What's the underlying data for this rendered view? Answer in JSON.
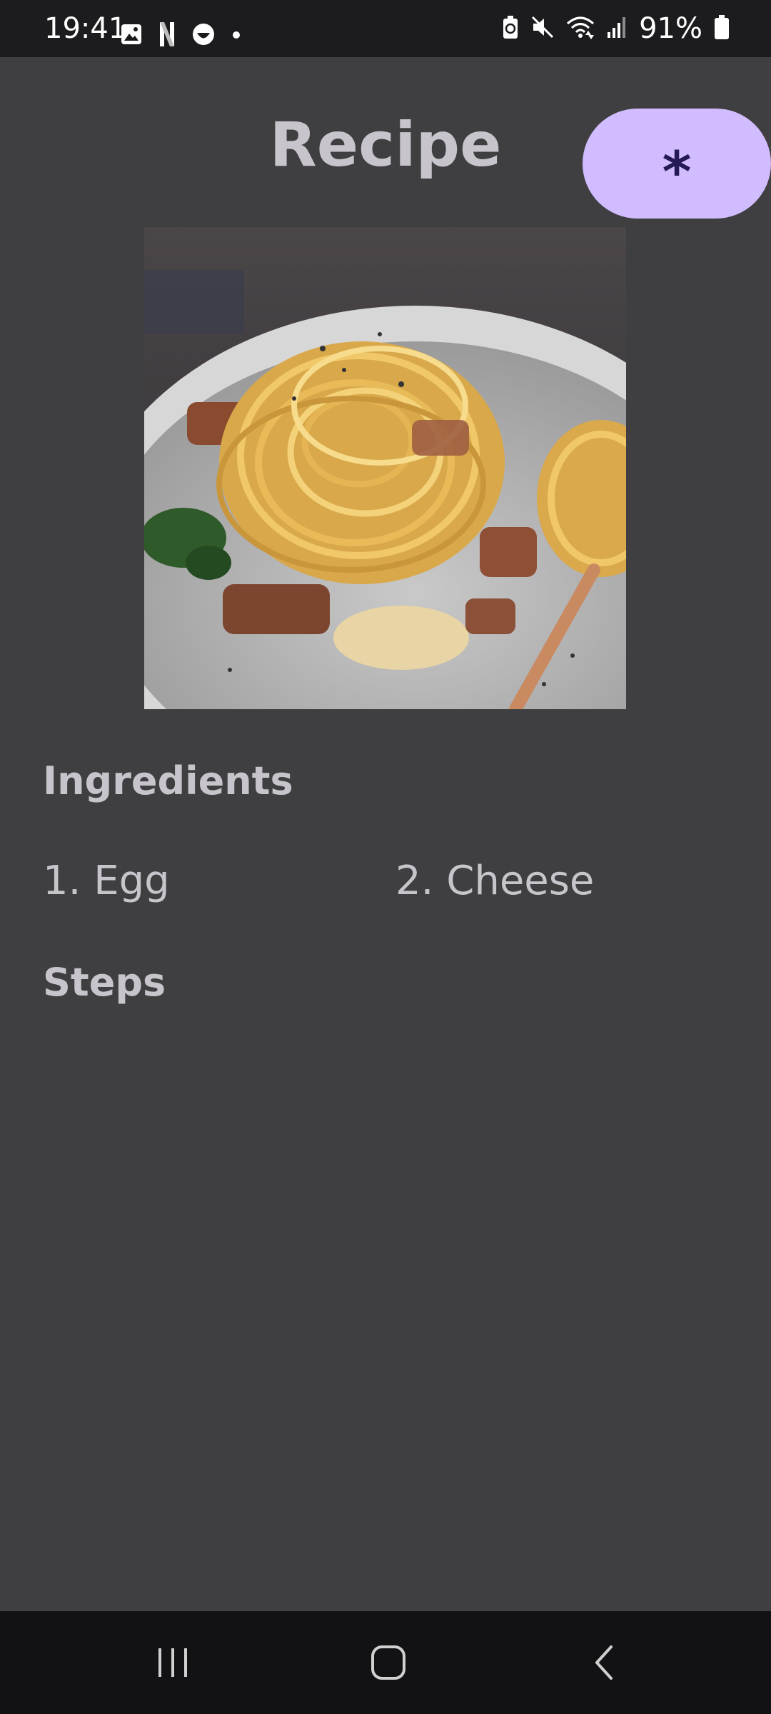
{
  "status_bar": {
    "time": "19:41",
    "battery_percent": "91%",
    "left_icons": [
      "gallery-icon",
      "netflix-icon",
      "face-icon",
      "dot-icon"
    ],
    "right_icons": [
      "battery-saver-icon",
      "mute-icon",
      "wifi-icon",
      "signal-icon",
      "battery-icon"
    ]
  },
  "header": {
    "title": "Recipe",
    "action_label": "*"
  },
  "recipe": {
    "image_alt": "pasta-carbonara",
    "ingredients_heading": "Ingredients",
    "ingredients": [
      "1. Egg",
      "2. Cheese"
    ],
    "steps_heading": "Steps"
  },
  "nav": {
    "buttons": [
      "recent-apps",
      "home",
      "back"
    ]
  },
  "colors": {
    "background": "#3f3f41",
    "accent": "#d0bcfe",
    "accent_text": "#261a55",
    "text": "#c8c4cc",
    "status_bar": "#1c1c1f",
    "nav_bar": "#121214"
  }
}
